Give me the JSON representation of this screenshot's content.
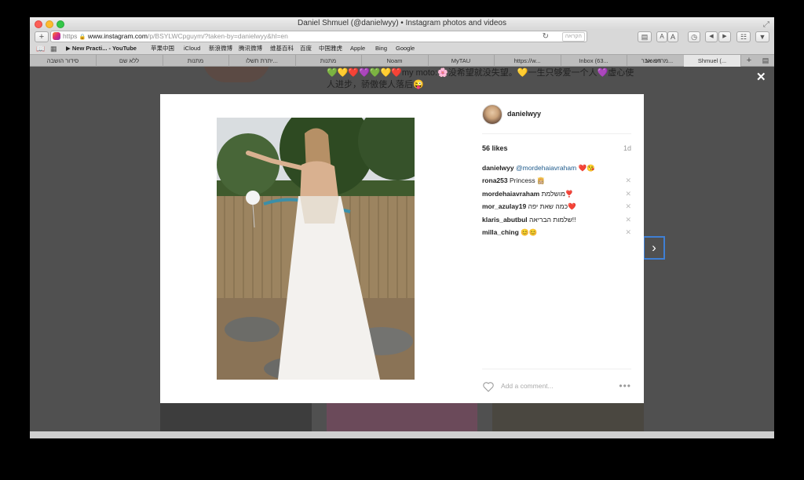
{
  "window": {
    "title": "Daniel Shmuel (@danielwyy) • Instagram photos and videos"
  },
  "toolbar": {
    "add_label": "+",
    "url_https": "https",
    "url_domain": "www.instagram.com",
    "url_path": "/p/BSYLWCpguym/?taken-by=danielwyy&hl=en",
    "reload_icon": "↻",
    "reader_label": "הקראה",
    "text_small": "A",
    "text_large": "A"
  },
  "bookmarks": [
    "New Practi... - YouTube",
    "苹果中国",
    "iCloud",
    "新浪微博",
    "腾讯微博",
    "维基百科",
    "百度",
    "中国雅虎",
    "Apple",
    "Bing",
    "Google"
  ],
  "tabs": [
    "סידור הושבה",
    "ללא שם",
    "מתנות",
    "יתרת תשלו...",
    "מתנות",
    "Noam",
    "MyTAU",
    "https://w...",
    "Inbox (63...",
    "מרדכי אבר...",
    "Noam",
    "Shmuel (..."
  ],
  "profile": {
    "bio_line1": "💚💛❤️💜💚💛❤️my moto:🌸没希望就没失望。💛一生只够爱一个人💜虚心使",
    "bio_line2": "人进步，骄傲使人落后😜"
  },
  "modal": {
    "close_icon": "✕",
    "next_icon": "›",
    "username": "danielwyy",
    "likes": "56 likes",
    "time_ago": "1d",
    "comments": [
      {
        "user": "danielwyy",
        "mention": "@mordehaiavraham",
        "text": " ❤️😘"
      },
      {
        "user": "rona253",
        "mention": "",
        "text": " Princess 👸🏼"
      },
      {
        "user": "mordehaiavraham",
        "mention": "",
        "text": " מושלמת❣️"
      },
      {
        "user": "mor_azulay19",
        "mention": "",
        "text": " כמה שאת יפה❤️"
      },
      {
        "user": "klaris_abutbul",
        "mention": "",
        "text": " שלמות הבריאה!!"
      },
      {
        "user": "milla_ching",
        "mention": "",
        "text": " 😊😊"
      }
    ],
    "delete_icon": "✕",
    "add_comment_placeholder": "Add a comment...",
    "more_icon": "•••"
  }
}
